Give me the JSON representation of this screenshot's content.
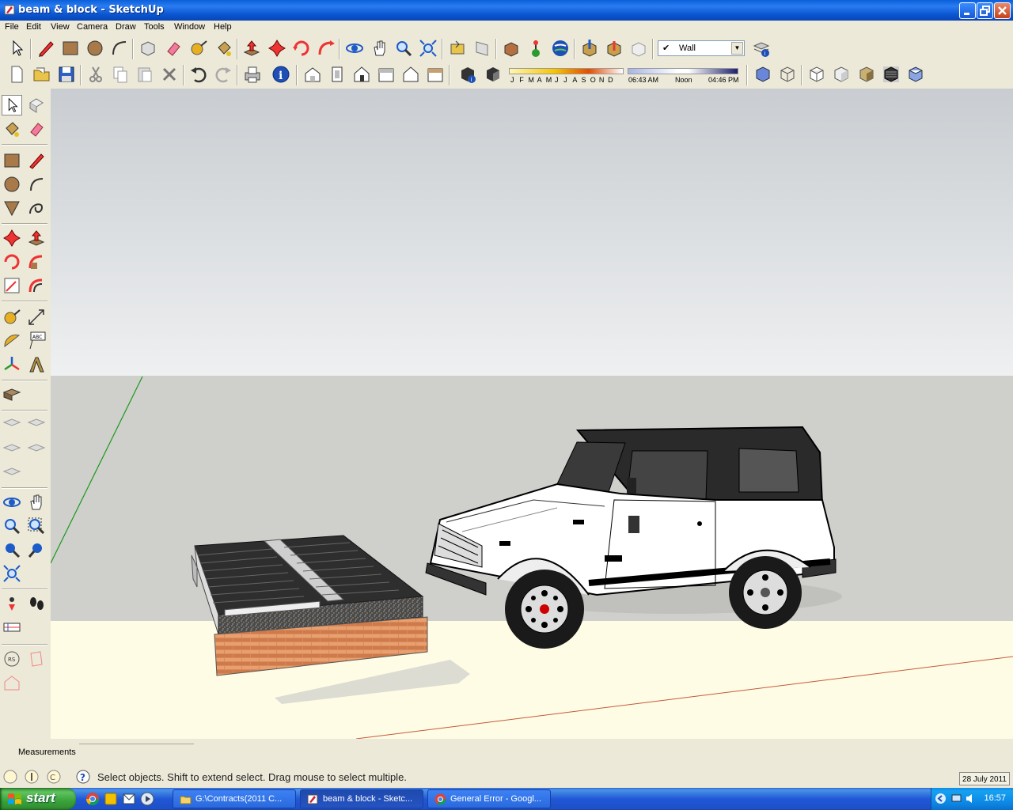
{
  "window": {
    "title": "beam & block - SketchUp"
  },
  "menu": [
    "File",
    "Edit",
    "View",
    "Camera",
    "Draw",
    "Tools",
    "Window",
    "Help"
  ],
  "toolbar": {
    "layer_value": "Wall",
    "months": [
      "J",
      "F",
      "M",
      "A",
      "M",
      "J",
      "J",
      "A",
      "S",
      "O",
      "N",
      "D"
    ],
    "time_start": "06:43 AM",
    "time_mid": "Noon",
    "time_end": "04:46 PM"
  },
  "measurements": {
    "label": "Measurements",
    "value": ""
  },
  "status": {
    "text": "Select objects. Shift to extend select. Drag mouse to select multiple.",
    "date": "28 July 2011"
  },
  "taskbar": {
    "start_label": "start",
    "tasks": [
      {
        "label": "G:\\Contracts(2011 C...",
        "icon": "folder-icon"
      },
      {
        "label": "beam & block - Sketc...",
        "icon": "sketchup-icon"
      },
      {
        "label": "General Error - Googl...",
        "icon": "chrome-icon"
      }
    ],
    "clock": "16:57"
  },
  "colors": {
    "sky_top": "#c9cdd1",
    "sky_bottom": "#eef0f1",
    "ground": "#fffce6",
    "far_ground": "#cfcfcc",
    "xp_blue": "#0b56d1"
  }
}
